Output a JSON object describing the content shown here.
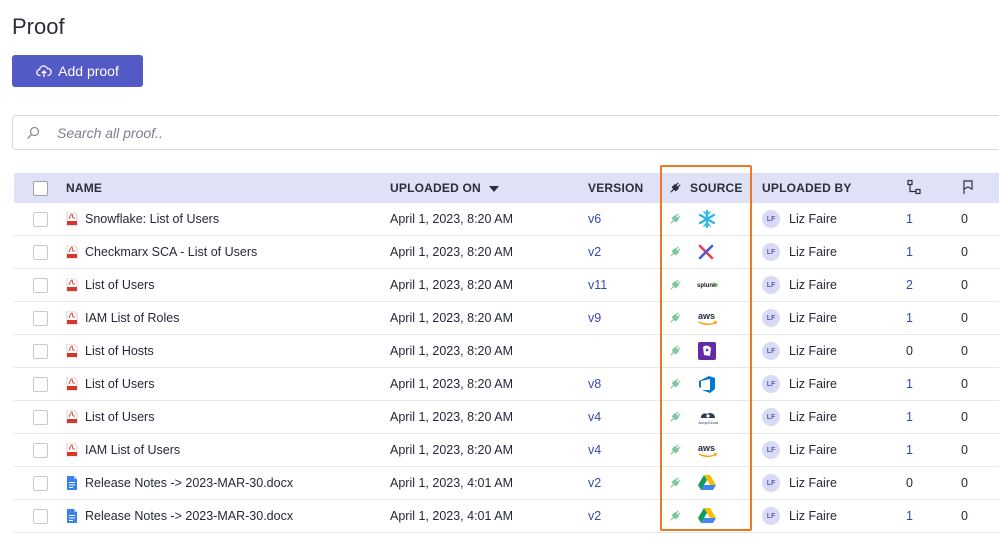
{
  "page": {
    "title": "Proof"
  },
  "toolbar": {
    "add_label": "Add proof"
  },
  "search": {
    "placeholder": "Search all proof.."
  },
  "table": {
    "columns": {
      "name": "NAME",
      "uploaded_on": "UPLOADED ON",
      "version": "VERSION",
      "source": "SOURCE",
      "uploaded_by": "UPLOADED BY"
    },
    "rows": [
      {
        "file_type": "pdf",
        "name": "Snowflake: List of Users",
        "date": "April 1, 2023, 8:20 AM",
        "version": "v6",
        "source": "snowflake",
        "avatar": "LF",
        "user": "Liz Faire",
        "links": "1",
        "flags": "0"
      },
      {
        "file_type": "pdf",
        "name": "Checkmarx SCA - List of Users",
        "date": "April 1, 2023, 8:20 AM",
        "version": "v2",
        "source": "checkmarx",
        "avatar": "LF",
        "user": "Liz Faire",
        "links": "1",
        "flags": "0"
      },
      {
        "file_type": "pdf",
        "name": "List of Users",
        "date": "April 1, 2023, 8:20 AM",
        "version": "v11",
        "source": "splunk",
        "avatar": "LF",
        "user": "Liz Faire",
        "links": "2",
        "flags": "0"
      },
      {
        "file_type": "pdf",
        "name": "IAM List of Roles",
        "date": "April 1, 2023, 8:20 AM",
        "version": "v9",
        "source": "aws",
        "avatar": "LF",
        "user": "Liz Faire",
        "links": "1",
        "flags": "0"
      },
      {
        "file_type": "pdf",
        "name": "List of Hosts",
        "date": "April 1, 2023, 8:20 AM",
        "version": "",
        "source": "datadog",
        "avatar": "LF",
        "user": "Liz Faire",
        "links": "0",
        "flags": "0"
      },
      {
        "file_type": "pdf",
        "name": "List of Users",
        "date": "April 1, 2023, 8:20 AM",
        "version": "v8",
        "source": "azure-devops",
        "avatar": "LF",
        "user": "Liz Faire",
        "links": "1",
        "flags": "0"
      },
      {
        "file_type": "pdf",
        "name": "List of Users",
        "date": "April 1, 2023, 8:20 AM",
        "version": "v4",
        "source": "jumpcloud",
        "avatar": "LF",
        "user": "Liz Faire",
        "links": "1",
        "flags": "0"
      },
      {
        "file_type": "pdf",
        "name": "IAM List of Users",
        "date": "April 1, 2023, 8:20 AM",
        "version": "v4",
        "source": "aws",
        "avatar": "LF",
        "user": "Liz Faire",
        "links": "1",
        "flags": "0"
      },
      {
        "file_type": "docx",
        "name": "Release Notes -> 2023-MAR-30.docx",
        "date": "April 1, 2023, 4:01 AM",
        "version": "v2",
        "source": "google-drive",
        "avatar": "LF",
        "user": "Liz Faire",
        "links": "0",
        "flags": "0"
      },
      {
        "file_type": "docx",
        "name": "Release Notes -> 2023-MAR-30.docx",
        "date": "April 1, 2023, 4:01 AM",
        "version": "v2",
        "source": "google-drive",
        "avatar": "LF",
        "user": "Liz Faire",
        "links": "1",
        "flags": "0"
      }
    ]
  },
  "colors": {
    "accent": "#5359c5",
    "header_bg": "#dfe1f7",
    "link": "#3b46b0",
    "highlight": "#ee7a1f",
    "plug": "#7fc6a4"
  }
}
